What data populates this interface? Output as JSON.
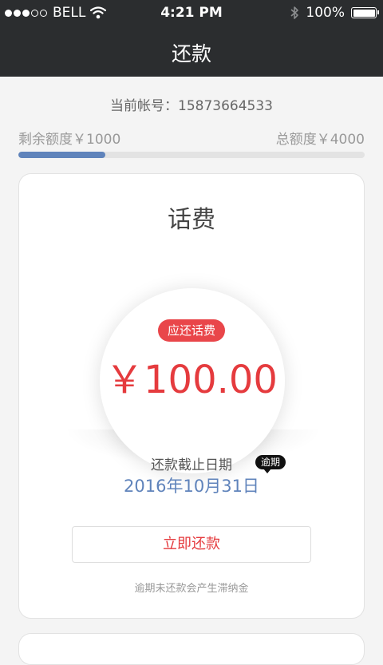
{
  "status_bar": {
    "carrier": "BELL",
    "time": "4:21 PM",
    "battery_percent": 100,
    "battery_text": "100%",
    "signal_icons": [
      "signal-dot-icon",
      "signal-dot-icon",
      "signal-dot-icon",
      "signal-dot-empty-icon",
      "signal-dot-empty-icon"
    ],
    "wifi_icon": "wifi-icon",
    "bluetooth_icon": "bluetooth-icon"
  },
  "nav": {
    "title": "还款"
  },
  "account": {
    "text": "当前帐号：15873664533"
  },
  "quota": {
    "remaining_text": "剩余额度￥1000",
    "total_text": "总额度￥4000",
    "remaining_value": 1000,
    "total_value": 4000
  },
  "card": {
    "title": "话费",
    "badge": "应还话费",
    "amount": "￥100.00",
    "deadline_label": "还款截止日期",
    "overdue_tag": "逾期",
    "deadline_date": "2016年10月31日",
    "repay_button": "立即还款",
    "late_note": "逾期未还款会产生滞纳金"
  },
  "colors": {
    "header_bg": "#2b2d2f",
    "accent_blue": "#5f83bb",
    "accent_red": "#e53b3e",
    "badge_red": "#e9464a"
  }
}
